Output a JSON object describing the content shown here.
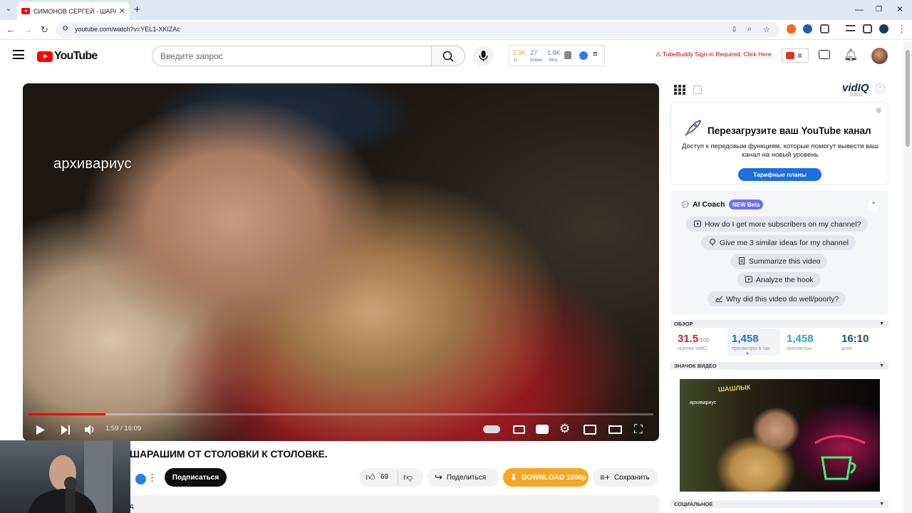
{
  "browser": {
    "tab_title": "СИМОНОВ СЕРГЕЙ - ШАРАШИ",
    "url": "youtube.com/watch?v=YEL1-XKIZAc"
  },
  "youtube": {
    "logo_text": "YouTube",
    "search_placeholder": "Введите запрос",
    "stats_widget": {
      "items": [
        {
          "value": "3.3K",
          "sub": "1г",
          "color": "#e8a23a"
        },
        {
          "value": "27",
          "sub": "60мин",
          "color": "#3a8fd8"
        },
        {
          "value": "1.8K",
          "sub": "48чс",
          "color": "#3a8fd8"
        }
      ]
    },
    "tubebuddy_text": "TubeBuddy Sign-in Required, Click Here"
  },
  "player": {
    "watermark": "архивариус",
    "time": "1:59 / 16:09",
    "progress": 0.123
  },
  "video": {
    "title": "ШАРАШИМ ОТ СТОЛОВКИ К СТОЛОВКЕ.",
    "subscribe_label": "Подписаться",
    "likes": "69",
    "share_label": "Поделиться",
    "download_label": "DOWNLOAD 1080p",
    "save_label": "Сохранить",
    "description_fragment": "д"
  },
  "vidiq": {
    "logo": "vidIQ",
    "tier": "basic",
    "promo": {
      "title": "Перезагрузите ваш YouTube канал",
      "text": "Доступ к передовым функциям, которые помогут вывести ваш канал на новый уровень",
      "button": "Тарифные планы"
    },
    "ai_coach": {
      "title": "AI Coach",
      "badge": "NEW Beta",
      "questions": [
        "How do I get more subscribers on my channel?",
        "Give me 3 similar ideas for my channel",
        "Summarize this video",
        "Analyze the hook",
        "Why did this video do well/poorly?"
      ]
    },
    "overview": {
      "header": "ОБЗОР",
      "score": "31.5",
      "score_max": "/100",
      "score_label": "оценка vidIQ",
      "views_per_hour": "1,458",
      "views_per_hour_label": "просмотры в час",
      "views": "1,458",
      "views_label": "просмотры",
      "duration": "16:10",
      "duration_label": "длит."
    },
    "thumbnail_header": "ЗНАЧОК ВИДЕО",
    "thumbnail_watermark": "архивариус",
    "thumbnail_sign": "ШАШЛЫК",
    "social_header": "СОЦИАЛЬНОЕ"
  }
}
